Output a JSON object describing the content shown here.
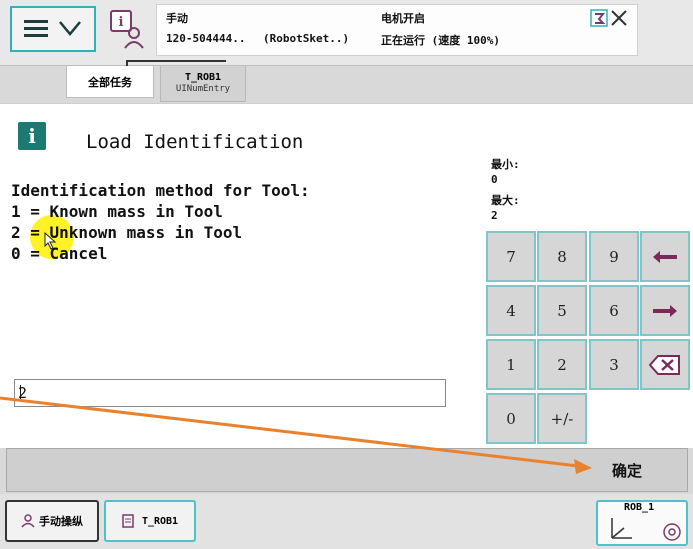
{
  "status": {
    "mode": "手动",
    "controller": "120-504444..",
    "program": "(RobotSket..)",
    "motors": "电机开启",
    "running": "正在运行 (速度 100%)"
  },
  "tabs": {
    "all_tasks": "全部任务",
    "task_name": "T_ROB1",
    "task_sub": "UINumEntry"
  },
  "dialog": {
    "title": "Load Identification",
    "lines": [
      "Identification method for Tool:",
      "1 = Known mass in Tool",
      "2 = Unknown mass in Tool",
      "0 = Cancel"
    ],
    "input_value": "2",
    "min_label": "最小:",
    "min_value": "0",
    "max_label": "最大:",
    "max_value": "2"
  },
  "keypad": {
    "k7": "7",
    "k8": "8",
    "k9": "9",
    "k4": "4",
    "k5": "5",
    "k6": "6",
    "k1": "1",
    "k2": "2",
    "k3": "3",
    "k0": "0",
    "kpm": "+/-"
  },
  "confirm_label": "确定",
  "taskbar": {
    "jog": "手动操纵",
    "task": "T_ROB1",
    "rob": "ROB_1"
  },
  "colors": {
    "accent": "#2fb3b8",
    "info_badge": "#1d7a72",
    "arrow": "#e9822f",
    "highlight": "#fff000"
  }
}
